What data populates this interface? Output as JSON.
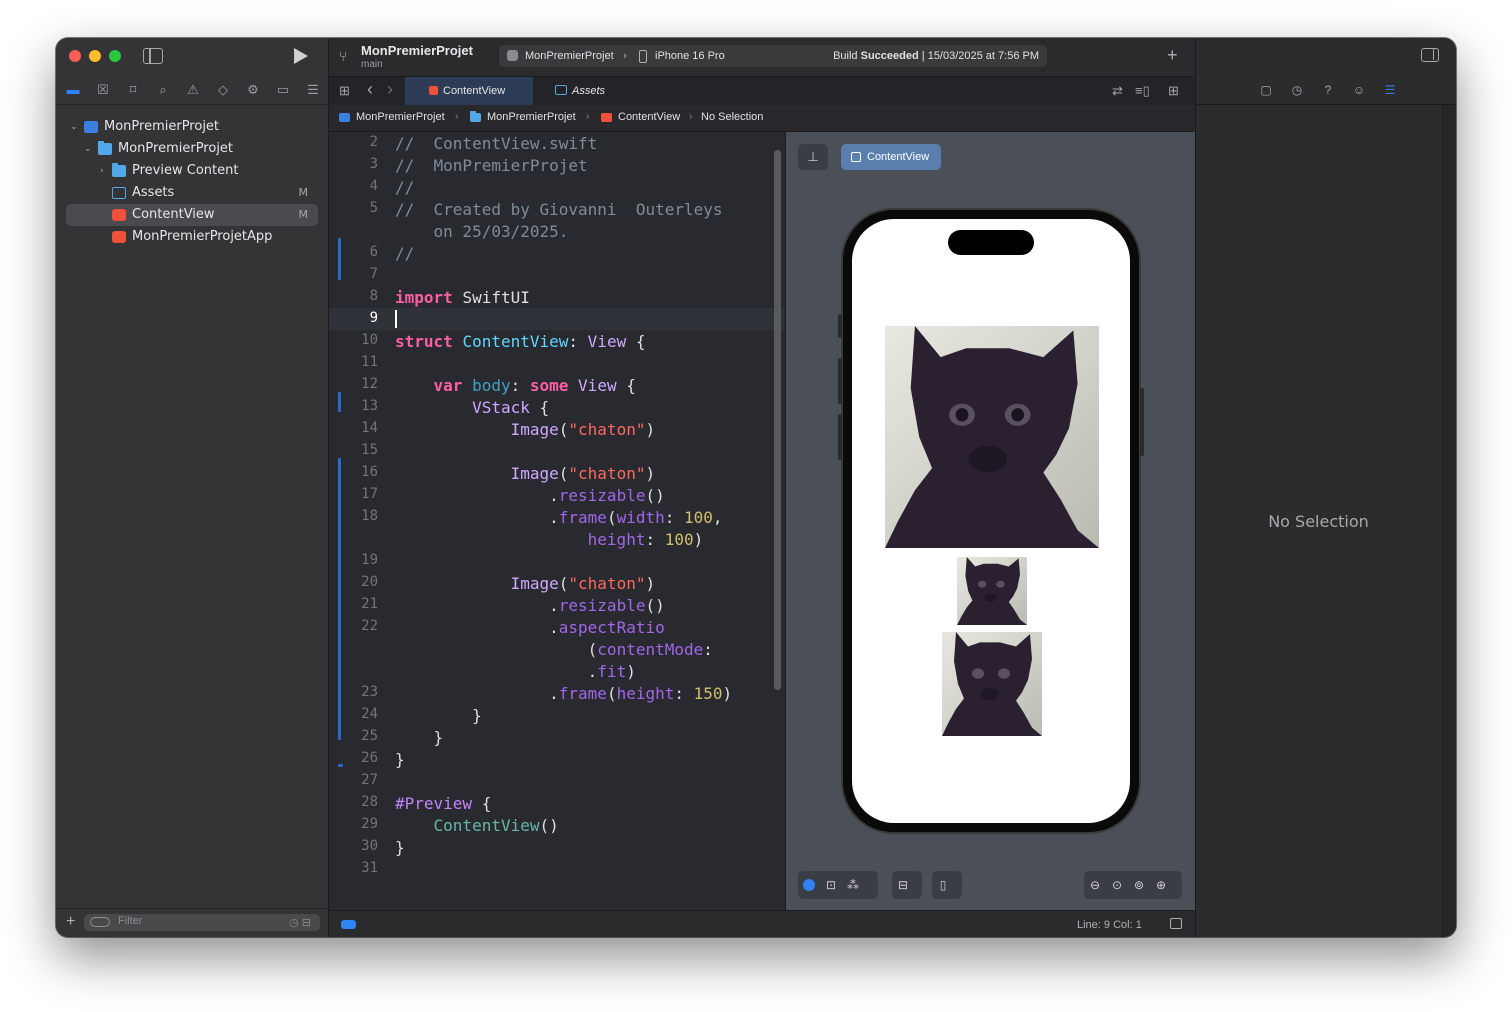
{
  "toolbar": {
    "project_name": "MonPremierProjet",
    "branch": "main",
    "scheme_app": "MonPremierProjet",
    "scheme_device": "iPhone 16 Pro",
    "build_status_strong": "Succeeded",
    "build_status_prefix": "Build",
    "build_status_date": "| 15/03/2025 at 7:56 PM"
  },
  "navigator": {
    "filter_placeholder": "Filter",
    "items": [
      {
        "label": "MonPremierProjet",
        "badge": ""
      },
      {
        "label": "MonPremierProjet",
        "badge": ""
      },
      {
        "label": "Preview Content",
        "badge": ""
      },
      {
        "label": "Assets",
        "badge": "M"
      },
      {
        "label": "ContentView",
        "badge": "M"
      },
      {
        "label": "MonPremierProjetApp",
        "badge": ""
      }
    ]
  },
  "tabs": [
    {
      "label": "ContentView",
      "icon": "swift-file-icon"
    },
    {
      "label": "Assets",
      "icon": "assets-icon"
    }
  ],
  "jump_bar": {
    "project": "MonPremierProjet",
    "group": "MonPremierProjet",
    "file": "ContentView",
    "symbol": "No Selection"
  },
  "editor": {
    "current_line": 9,
    "lines": [
      "2",
      "3",
      "4",
      "5",
      "6",
      "7",
      "8",
      "9",
      "10",
      "11",
      "12",
      "13",
      "14",
      "15",
      "16",
      "17",
      "18",
      "19",
      "20",
      "21",
      "22",
      "23",
      "24",
      "25",
      "26",
      "27",
      "28",
      "29",
      "30",
      "31"
    ]
  },
  "canvas": {
    "preview_label": "ContentView",
    "image_name": "chaton"
  },
  "status": {
    "line_col": "Line: 9  Col: 1"
  },
  "inspector": {
    "empty_text": "No Selection"
  },
  "colors": {
    "accent": "#2f83f5",
    "keyword": "#fc5fa3",
    "type": "#5dd8ff",
    "string": "#fc6a5d",
    "number": "#d0bf69",
    "comment": "#7f8c98"
  }
}
